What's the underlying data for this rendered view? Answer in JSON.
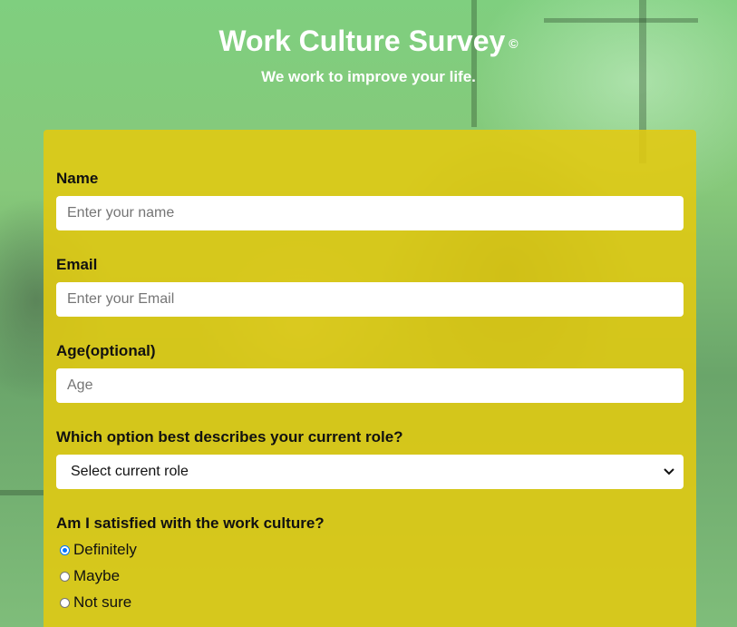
{
  "header": {
    "title": "Work Culture Survey",
    "copyright_symbol": "©",
    "subtitle": "We work to improve your life."
  },
  "form": {
    "name": {
      "label": "Name",
      "placeholder": "Enter your name"
    },
    "email": {
      "label": "Email",
      "placeholder": "Enter your Email"
    },
    "age": {
      "label": "Age(optional)",
      "placeholder": "Age"
    },
    "role": {
      "label": "Which option best describes your current role?",
      "selected": "Select current role"
    },
    "satisfaction": {
      "label": "Am I satisfied with the work culture?",
      "options": [
        {
          "label": "Definitely",
          "checked": true
        },
        {
          "label": "Maybe",
          "checked": false
        },
        {
          "label": "Not sure",
          "checked": false
        }
      ]
    }
  },
  "colors": {
    "form_background": "#e2ca10",
    "page_background": "#7fcf7f",
    "radio_accent": "#0075ff"
  }
}
